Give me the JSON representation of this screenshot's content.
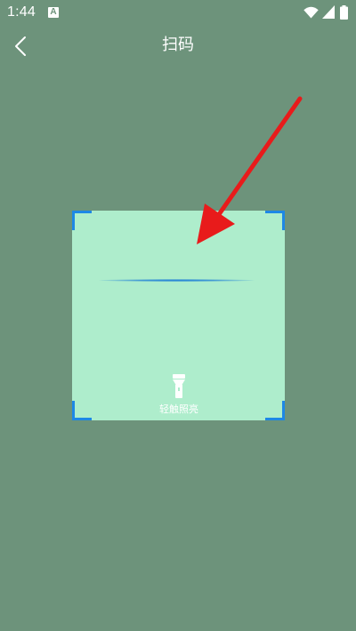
{
  "status_bar": {
    "time": "1:44",
    "notification_icon": "a-box-icon",
    "notification_glyph": "A",
    "icons": [
      "wifi-icon",
      "signal-icon",
      "battery-icon"
    ]
  },
  "header": {
    "title": "扫码",
    "back_icon": "chevron-left-icon"
  },
  "scanner": {
    "torch_label": "轻触照亮",
    "torch_icon": "flashlight-icon"
  },
  "colors": {
    "background": "#6d937b",
    "scan_area": "#aeedcc",
    "corner": "#1e88e5",
    "scan_line": "#1e7fd6",
    "annotation_arrow": "#e81b1b"
  }
}
